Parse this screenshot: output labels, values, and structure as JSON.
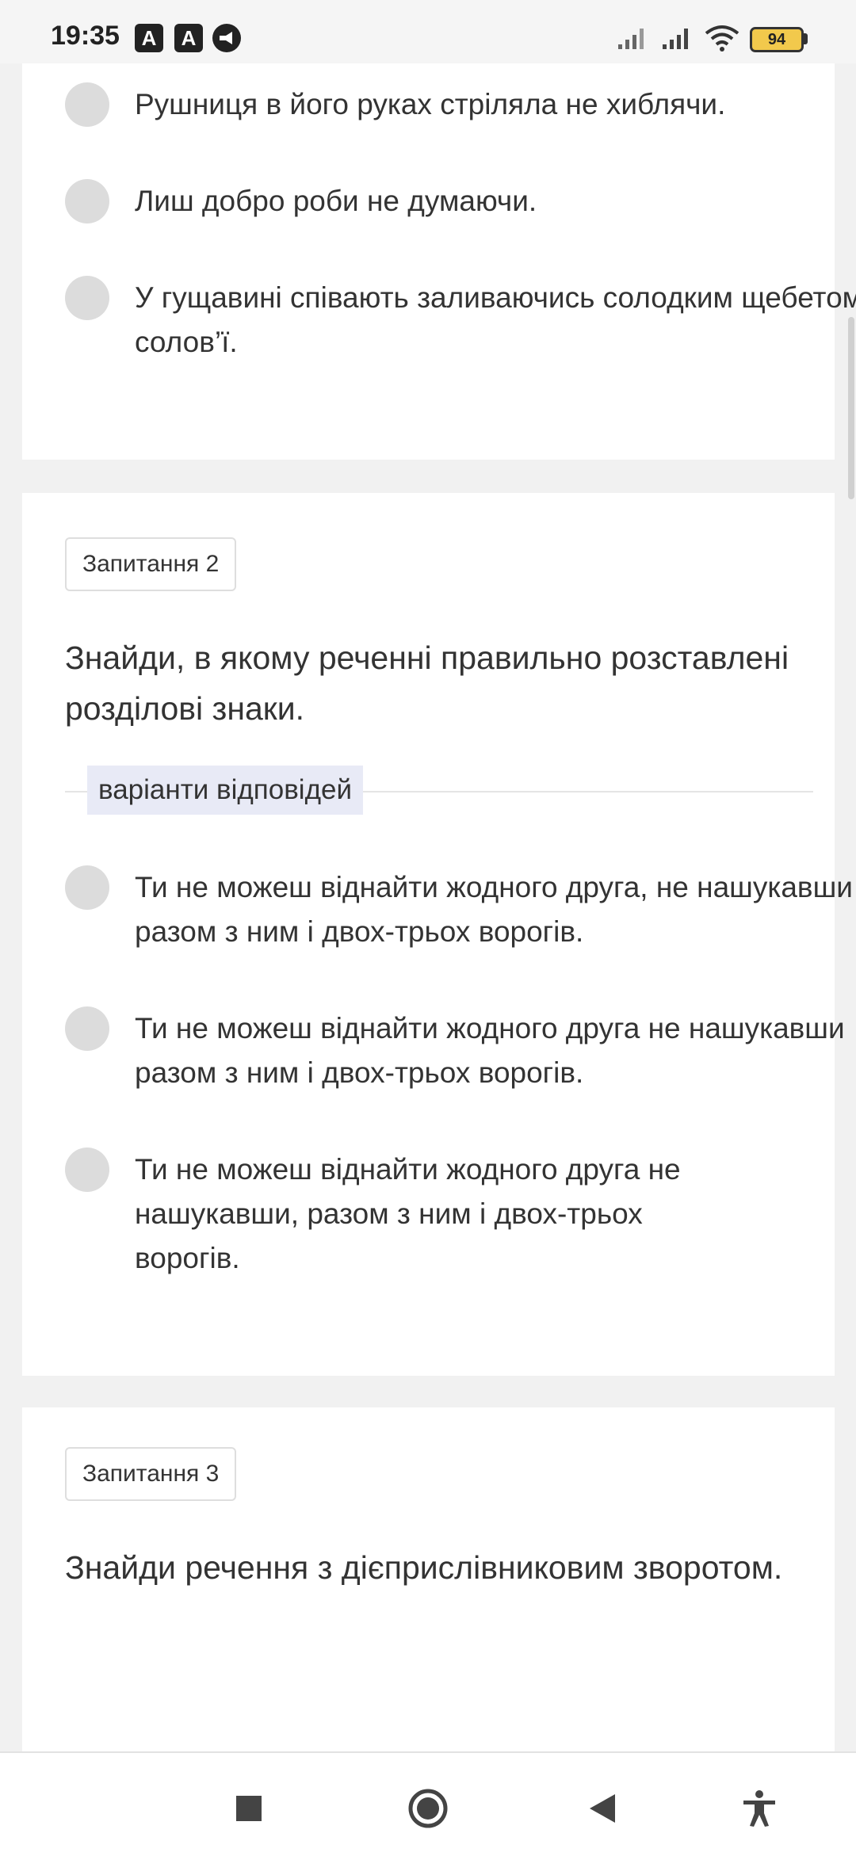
{
  "status_bar": {
    "time": "19:35",
    "notification_icons": [
      "a-app-icon",
      "a-app-icon",
      "megaphone-icon"
    ],
    "notif_letter": "A",
    "battery": "94",
    "battery_color": "#f2c94c"
  },
  "question_1": {
    "options": [
      {
        "text": "Рушниця в його руках стріляла не хиблячи."
      },
      {
        "text": "Лиш добро роби не думаючи."
      },
      {
        "text": "У гущавині співають заливаючись солодким щебетом солов’ї."
      }
    ]
  },
  "question_2": {
    "badge": "Запитання 2",
    "text": "Знайди, в якому реченні правильно розставлені розділові знаки.",
    "answers_label": "варіанти відповідей",
    "options": [
      {
        "text": "Ти не можеш віднайти жодного друга, не нашукавши разом з ним і двох-трьох ворогів."
      },
      {
        "text": "Ти не можеш віднайти жодного друга не нашукавши разом з ним і двох-трьох ворогів."
      },
      {
        "text": "Ти не можеш віднайти жодного друга не нашукавши, разом з ним і двох-трьох ворогів."
      }
    ]
  },
  "question_3": {
    "badge": "Запитання 3",
    "text": "Знайди речення з дієприслівниковим зворотом."
  },
  "nav_bar": {
    "icons": [
      "recents-square-icon",
      "home-circle-icon",
      "back-triangle-icon",
      "accessibility-icon"
    ]
  }
}
